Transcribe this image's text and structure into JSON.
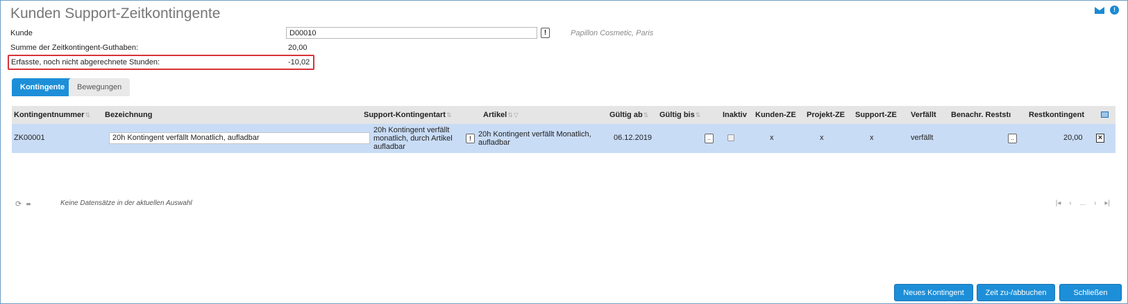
{
  "page": {
    "title": "Kunden Support-Zeitkontingente"
  },
  "icons": {
    "mail": "mail-icon",
    "info": "info-icon"
  },
  "form": {
    "kunde_label": "Kunde",
    "kunde_value": "D00010",
    "customer_name": "Papillon Cosmetic, Paris",
    "summe_label": "Summe der Zeitkontingent-Guthaben:",
    "summe_value": "20,00",
    "erfasst_label": "Erfasste, noch nicht abgerechnete Stunden:",
    "erfasst_value": "-10,02"
  },
  "tabs": [
    {
      "label": "Kontingente",
      "active": true
    },
    {
      "label": "Bewegungen",
      "active": false
    }
  ],
  "grid": {
    "columns": [
      "Kontingentnummer",
      "Bezeichnung",
      "Support-Kontingentart",
      "Artikel",
      "Gültig ab",
      "Gültig bis",
      "Inaktiv",
      "Kunden-ZE",
      "Projekt-ZE",
      "Support-ZE",
      "Verfällt",
      "Benachr. Reststı",
      "Restkontingent"
    ],
    "rows": [
      {
        "kontingentnummer": "ZK00001",
        "bezeichnung": "20h Kontingent verfällt Monatlich, aufladbar",
        "kontingentart_l1": "20h Kontingent verfällt",
        "kontingentart_l2": "monatlich, durch Artikel",
        "kontingentart_l3": "aufladbar",
        "artikel_l1": "20h Kontingent verfällt Monatlich,",
        "artikel_l2": "aufladbar",
        "gueltig_ab": "06.12.2019",
        "gueltig_bis": "",
        "inaktiv": false,
        "kunden_ze": "x",
        "projekt_ze": "x",
        "support_ze": "x",
        "verfaellt": "verfällt",
        "restkontingent": "20,00"
      }
    ]
  },
  "footer": {
    "no_records": "Keine Datensätze in der aktuellen Auswahl",
    "pager_ellipsis": "..."
  },
  "buttons": {
    "neues": "Neues Kontingent",
    "zeit": "Zeit zu-/abbuchen",
    "schliessen": "Schließen",
    "lookup": "!",
    "ellipsis": "..",
    "close": "×"
  }
}
